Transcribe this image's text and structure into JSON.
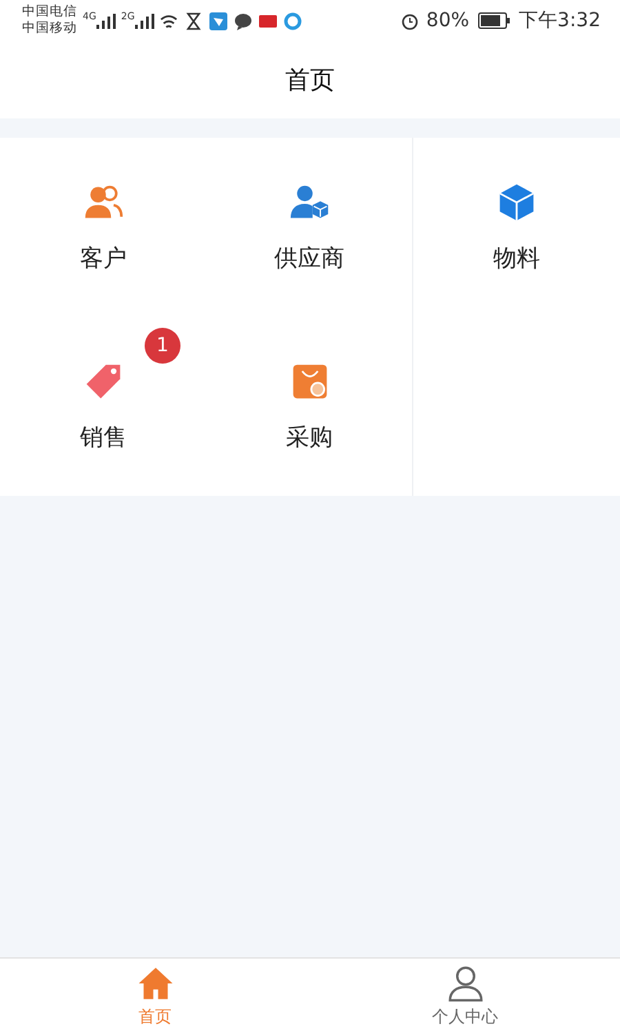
{
  "status_bar": {
    "carriers": [
      "中国电信",
      "中国移动"
    ],
    "network_1": "4G",
    "network_2": "2G",
    "battery": "80%",
    "time": "下午3:32"
  },
  "header": {
    "title": "首页"
  },
  "menu": [
    {
      "kind": "customer",
      "label": "客户"
    },
    {
      "kind": "supplier",
      "label": "供应商"
    },
    {
      "kind": "material",
      "label": "物料"
    },
    {
      "kind": "sales",
      "label": "销售",
      "badge": "1"
    },
    {
      "kind": "purchase",
      "label": "采购"
    }
  ],
  "tab_bar": [
    {
      "kind": "home",
      "label": "首页",
      "selected": true
    },
    {
      "kind": "person",
      "label": "个人中心",
      "selected": false
    }
  ]
}
